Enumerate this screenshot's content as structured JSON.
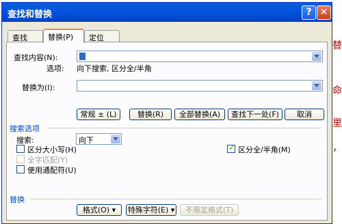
{
  "window": {
    "title": "查找和替换"
  },
  "tabs": [
    {
      "label": "查找(D)"
    },
    {
      "label": "替换(P)"
    },
    {
      "label": "定位(G)"
    }
  ],
  "find": {
    "label": "查找内容(N):",
    "value": "",
    "options_label": "选项:",
    "options_value": "向下搜索, 区分全/半角"
  },
  "replace": {
    "label": "替换为(I):",
    "value": ""
  },
  "buttons": {
    "less": "常规 ± (L)",
    "replace": "替换(R)",
    "replace_all": "全部替换(A)",
    "find_next": "查找下一处(F)",
    "cancel": "取消"
  },
  "search_options": {
    "header": "搜索选项",
    "search_label": "搜索:",
    "search_value": "向下",
    "match_case": "区分大小写(H)",
    "whole_word": "全字匹配(Y)",
    "wildcards": "使用通配符(U)",
    "full_half": "区分全/半角(M)"
  },
  "replace_section": {
    "header": "替换",
    "format": "格式(O) ▾",
    "special": "特殊字符(E) ▾",
    "no_format": "不限定格式(T)"
  },
  "bg_glyphs": [
    "替",
    "命",
    "里",
    "，"
  ],
  "colors": {
    "title_bar": "#0355e0",
    "section_header": "#0046d5",
    "background_text": "#c00000"
  }
}
